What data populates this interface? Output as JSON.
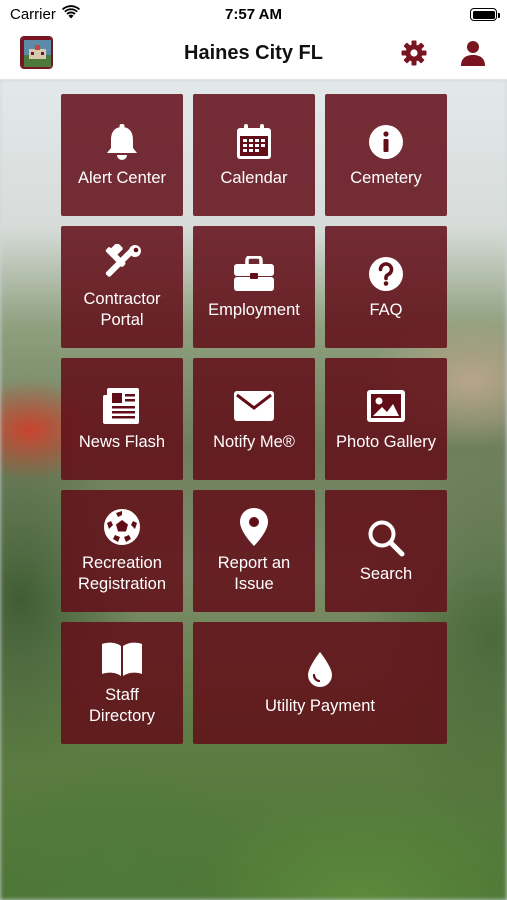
{
  "status_bar": {
    "carrier": "Carrier",
    "time": "7:57 AM"
  },
  "nav": {
    "title": "Haines City FL",
    "logo_icon": "city-logo",
    "settings_icon": "gear-icon",
    "profile_icon": "user-icon"
  },
  "colors": {
    "tile_background": "#620e18",
    "accent": "#7a1420",
    "tile_text": "#ffffff"
  },
  "tiles": [
    {
      "label": "Alert Center",
      "icon": "bell-icon"
    },
    {
      "label": "Calendar",
      "icon": "calendar-icon"
    },
    {
      "label": "Cemetery",
      "icon": "info-icon"
    },
    {
      "label": "Contractor\nPortal",
      "icon": "tools-icon"
    },
    {
      "label": "Employment",
      "icon": "briefcase-icon"
    },
    {
      "label": "FAQ",
      "icon": "question-icon"
    },
    {
      "label": "News Flash",
      "icon": "newspaper-icon"
    },
    {
      "label": "Notify Me®",
      "icon": "envelope-icon"
    },
    {
      "label": "Photo Gallery",
      "icon": "image-icon"
    },
    {
      "label": "Recreation\nRegistration",
      "icon": "soccer-ball-icon"
    },
    {
      "label": "Report an\nIssue",
      "icon": "map-pin-icon"
    },
    {
      "label": "Search",
      "icon": "search-icon"
    },
    {
      "label": "Staff\nDirectory",
      "icon": "book-icon"
    },
    {
      "label": "Utility Payment",
      "icon": "water-drop-icon"
    }
  ]
}
